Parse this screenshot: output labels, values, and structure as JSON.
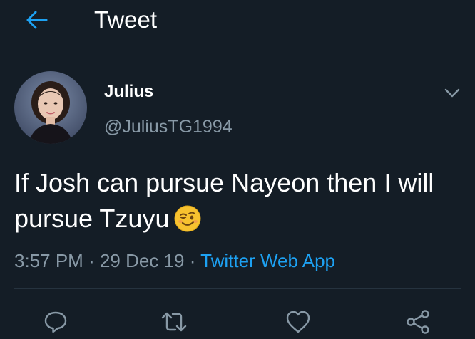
{
  "header": {
    "title": "Tweet",
    "back_icon": "arrow-left-icon"
  },
  "colors": {
    "background": "#141d26",
    "accent": "#1da1f2",
    "secondary_text": "#8899a6"
  },
  "tweet": {
    "display_name": "Julius",
    "handle": "@JuliusTG1994",
    "text": "If Josh can pursue Nayeon then I will pursue Tzuyu",
    "emoji": "winking-face-emoji",
    "time": "3:57 PM",
    "date": "29 Dec 19",
    "source": "Twitter Web App",
    "separator": "·"
  },
  "actions": {
    "icons": [
      "reply-icon",
      "retweet-icon",
      "like-icon",
      "share-icon"
    ]
  }
}
